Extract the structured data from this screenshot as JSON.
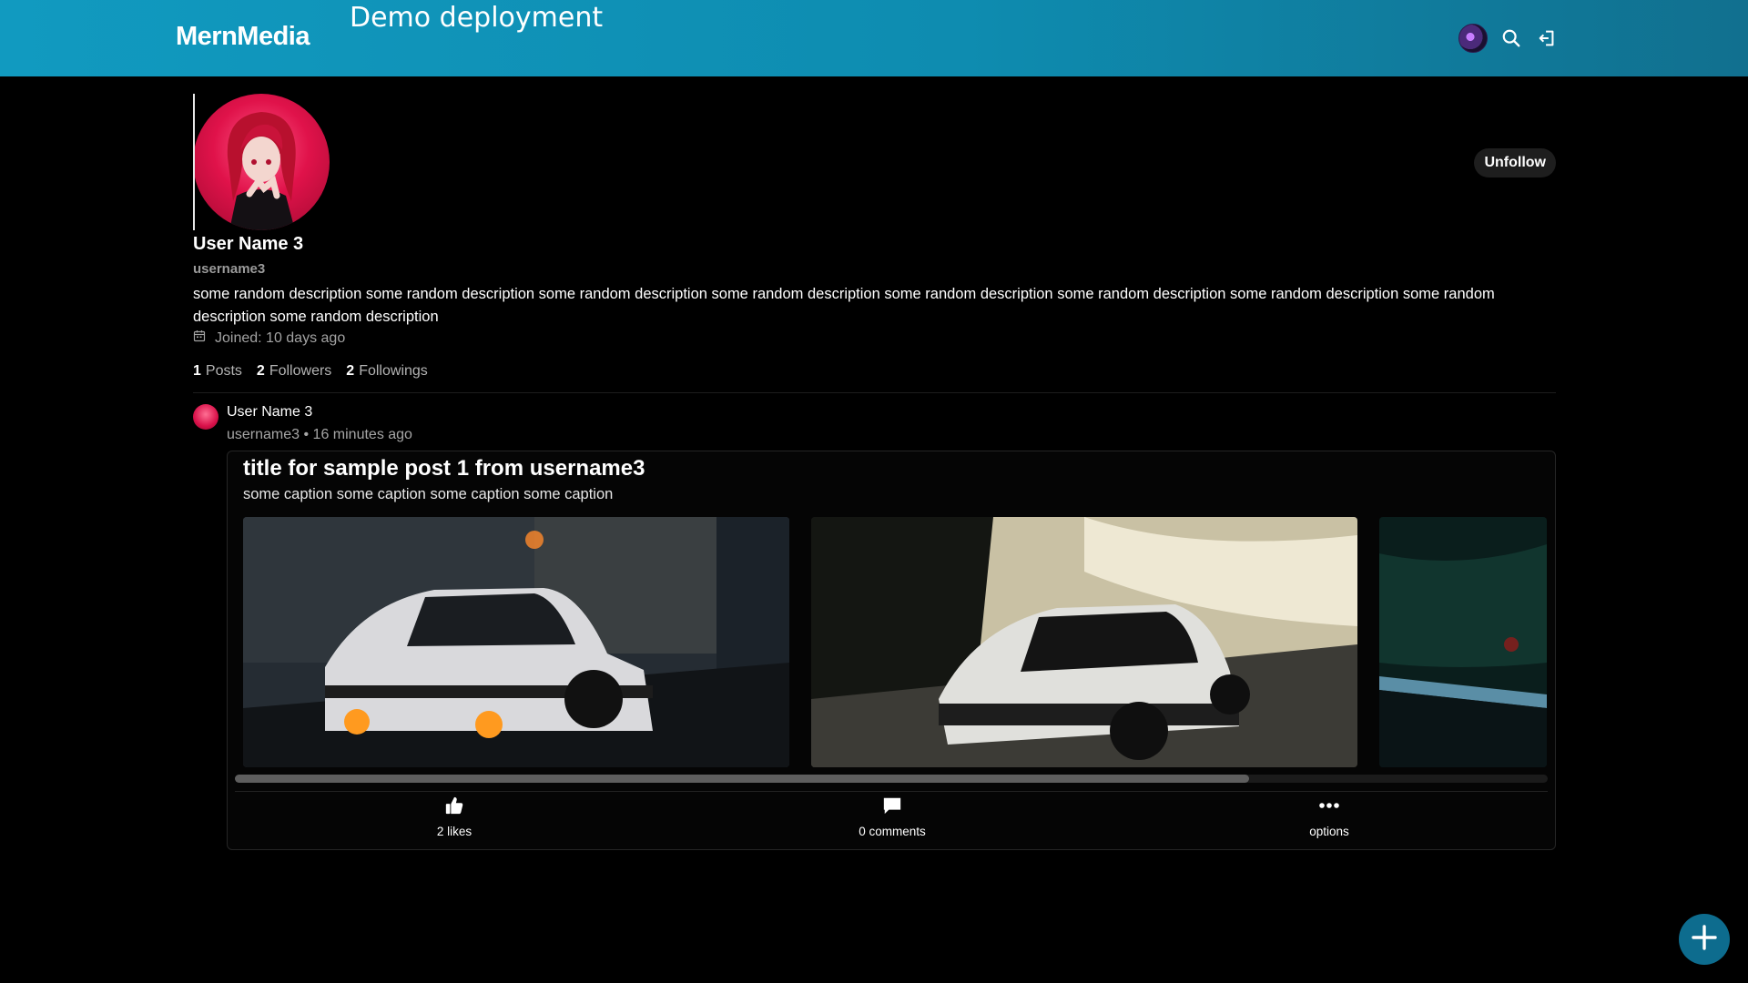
{
  "header": {
    "brand": "MernMedia",
    "banner": "Demo deployment",
    "icons": [
      "user-avatar",
      "search-icon",
      "logout-icon"
    ]
  },
  "profile": {
    "display_name": "User Name 3",
    "username": "username3",
    "bio": "some random description some random description some random description some random description some random description some random description some random description some random description some random description",
    "joined": "Joined: 10 days ago",
    "follow_button": "Unfollow",
    "stats": {
      "posts_count": "1",
      "posts_label": "Posts",
      "followers_count": "2",
      "followers_label": "Followers",
      "followings_count": "2",
      "followings_label": "Followings"
    }
  },
  "post": {
    "author_name": "User Name 3",
    "author_handle": "username3",
    "time_ago": "16 minutes ago",
    "title": "title for sample post 1 from username3",
    "caption": "some caption some caption some caption some caption",
    "image_count_visible": 3,
    "likes": "2 likes",
    "comments": "0 comments",
    "options": "options"
  },
  "colors": {
    "header_gradient_start": "#119ac0",
    "header_gradient_end": "#11708f",
    "background": "#000000",
    "fab": "#0d6c8e"
  }
}
